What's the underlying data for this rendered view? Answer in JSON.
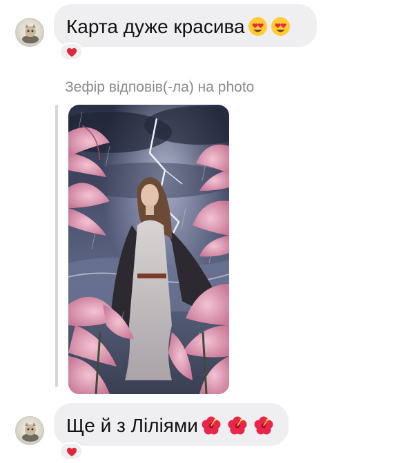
{
  "messages": [
    {
      "text": "Карта дуже красива",
      "emojis": [
        "heart-eyes-emoji",
        "heart-eyes-emoji"
      ],
      "reaction": "red-heart"
    },
    {
      "text": "Ще й з Ліліями",
      "emojis": [
        "hibiscus-emoji",
        "hibiscus-emoji",
        "hibiscus-emoji"
      ],
      "reaction": "red-heart"
    }
  ],
  "reply": {
    "label": "Зефір відповів(-ла) на photo"
  },
  "colors": {
    "bubble": "#efeff1",
    "reply_label": "#8a8a8e",
    "reaction_heart": "#e0263c"
  }
}
